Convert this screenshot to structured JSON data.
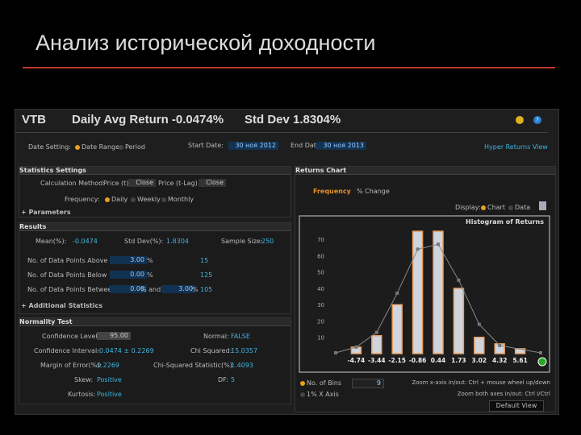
{
  "title": "Анализ исторической доходности",
  "header": {
    "ticker": "VTB",
    "avg_return": "Daily Avg Return -0.0474%",
    "std_dev": "Std Dev 1.8304%"
  },
  "date_settings": {
    "label": "Date Setting:",
    "opt1": "Date Range",
    "opt2": "Period",
    "start_label": "Start Date:",
    "start": "30 ноя 2012",
    "end_label": "End Date:",
    "end": "30 ноя 2013",
    "link": "Hyper Returns View"
  },
  "stats": {
    "title": "Statistics Settings",
    "calc_label": "Calculation Method:",
    "price_t": "Price (t)",
    "close1": "Close",
    "price_t1": "Price (t-Lag)",
    "close2": "Close",
    "freq_label": "Frequency:",
    "daily": "Daily",
    "weekly": "Weekly",
    "monthly": "Monthly",
    "parameters": "Parameters"
  },
  "results": {
    "title": "Results",
    "mean_label": "Mean(%):",
    "mean": "-0.0474",
    "sd_label": "Std Dev(%):",
    "sd": "1.8304",
    "n_label": "Sample Size:",
    "n": "250",
    "above_label": "No. of Data Points Above",
    "above_val": "3.00",
    "above_count": "15",
    "below_label": "No. of Data Points Below",
    "below_val": "0.00",
    "below_count": "125",
    "between_label": "No. of Data Points Between",
    "between_val1": "0.00",
    "and": "% and",
    "between_val2": "3.00",
    "between_count": "105",
    "pct": "%",
    "additional": "Additional Statistics"
  },
  "normality": {
    "title": "Normality Test",
    "cl_label": "Confidence Level:",
    "cl": "95.00",
    "ci_label": "Confidence Interval:",
    "ci": "-0.0474 ± 0.2269",
    "me_label": "Margin of Error(%):",
    "me": "0.2269",
    "skew_label": "Skew:",
    "skew": "Positive",
    "kurt_label": "Kurtosis:",
    "kurt": "Positive",
    "normal_label": "Normal:",
    "normal": "FALSE",
    "chi_label": "Chi Squared:",
    "chi": "15.0357",
    "chis_label": "Chi-Squared Statistic(%):",
    "chis": "1.4093",
    "df_label": "DF:",
    "df": "5"
  },
  "chart_panel": {
    "title": "Returns Chart",
    "tab1": "Frequency",
    "tab2": "% Change",
    "display_label": "Display:",
    "chart_opt": "Chart",
    "data_opt": "Data",
    "bins_label": "No. of Bins",
    "bins": "9",
    "log_label": "1% X Axis",
    "zoom1": "Zoom x-axis in/out: Ctrl + mouse wheel up/down",
    "zoom2": "Zoom both axes in/out: Ctrl I/Ctrl",
    "default_view": "Default View"
  },
  "chart_data": {
    "type": "bar",
    "title": "Histogram of Returns",
    "categories": [
      "-4.74",
      "-3.44",
      "-2.15",
      "-0.86",
      "0.44",
      "1.73",
      "3.02",
      "4.32",
      "5.61"
    ],
    "values": [
      4,
      11,
      30,
      75,
      75,
      40,
      10,
      6,
      3
    ],
    "curve": [
      0.5,
      4,
      13,
      37,
      64,
      67,
      45,
      18,
      5,
      0.5
    ],
    "yticks": [
      "10",
      "20",
      "30",
      "40",
      "50",
      "60",
      "70"
    ],
    "ylim": [
      0,
      78
    ],
    "colors": {
      "bar": "#d0d4dc",
      "edge": "#e8a060",
      "curve": "#888888"
    }
  }
}
